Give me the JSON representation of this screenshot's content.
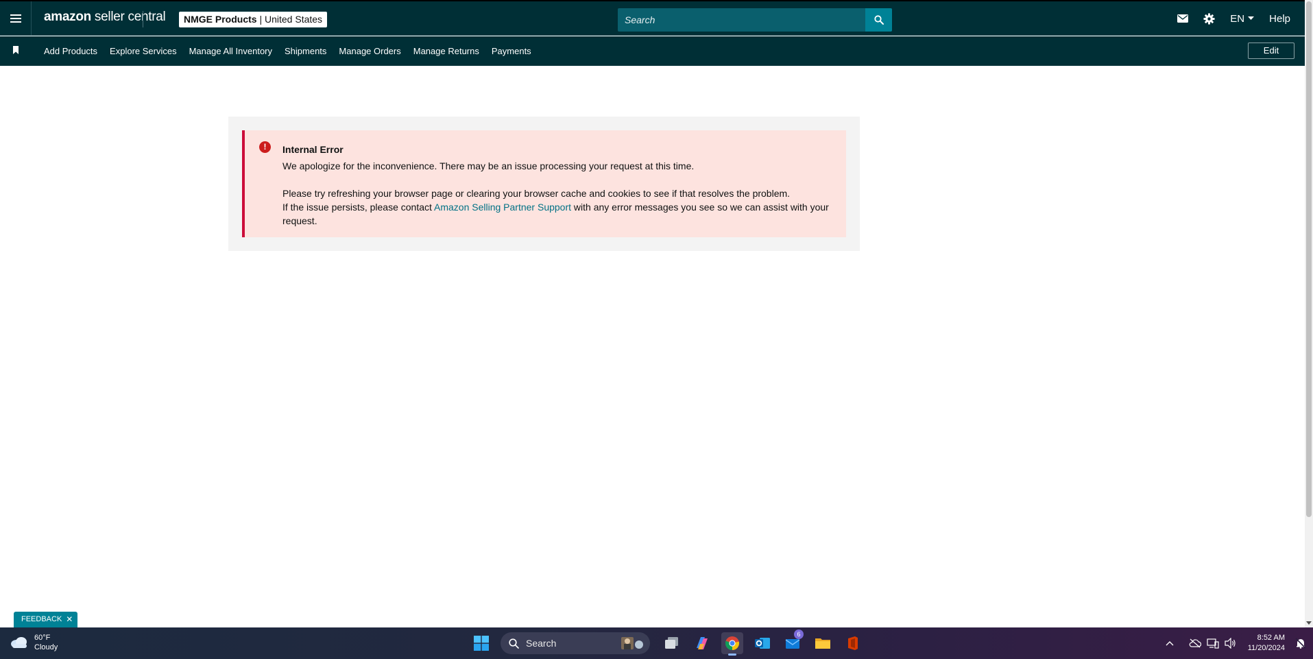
{
  "header": {
    "logo_brand": "amazon",
    "logo_suffix": " seller central",
    "account_name": "NMGE Products",
    "account_sep": " | ",
    "account_region": "United States",
    "search_placeholder": "Search",
    "language": "EN",
    "help": "Help"
  },
  "nav": {
    "items": [
      "Add Products",
      "Explore Services",
      "Manage All Inventory",
      "Shipments",
      "Manage Orders",
      "Manage Returns",
      "Payments"
    ],
    "edit": "Edit"
  },
  "error": {
    "title": "Internal Error",
    "line1": "We apologize for the inconvenience. There may be an issue processing your request at this time.",
    "line2": "Please try refreshing your browser page or clearing your browser cache and cookies to see if that resolves the problem.",
    "line3_pre": "If the issue persists, please contact ",
    "line3_link": "Amazon Selling Partner Support",
    "line3_post": " with any error messages you see so we can assist with your request.",
    "icon": "!"
  },
  "feedback": {
    "label": "FEEDBACK",
    "close": "✕"
  },
  "taskbar": {
    "weather_temp": "60°F",
    "weather_desc": "Cloudy",
    "search_label": "Search",
    "mail_badge": "6",
    "time": "8:52 AM",
    "date": "11/20/2024"
  },
  "colors": {
    "header_bg": "#002f36",
    "search_button": "#008296",
    "error_border": "#cc0c39",
    "error_bg": "#fde3df",
    "link": "#007185"
  }
}
